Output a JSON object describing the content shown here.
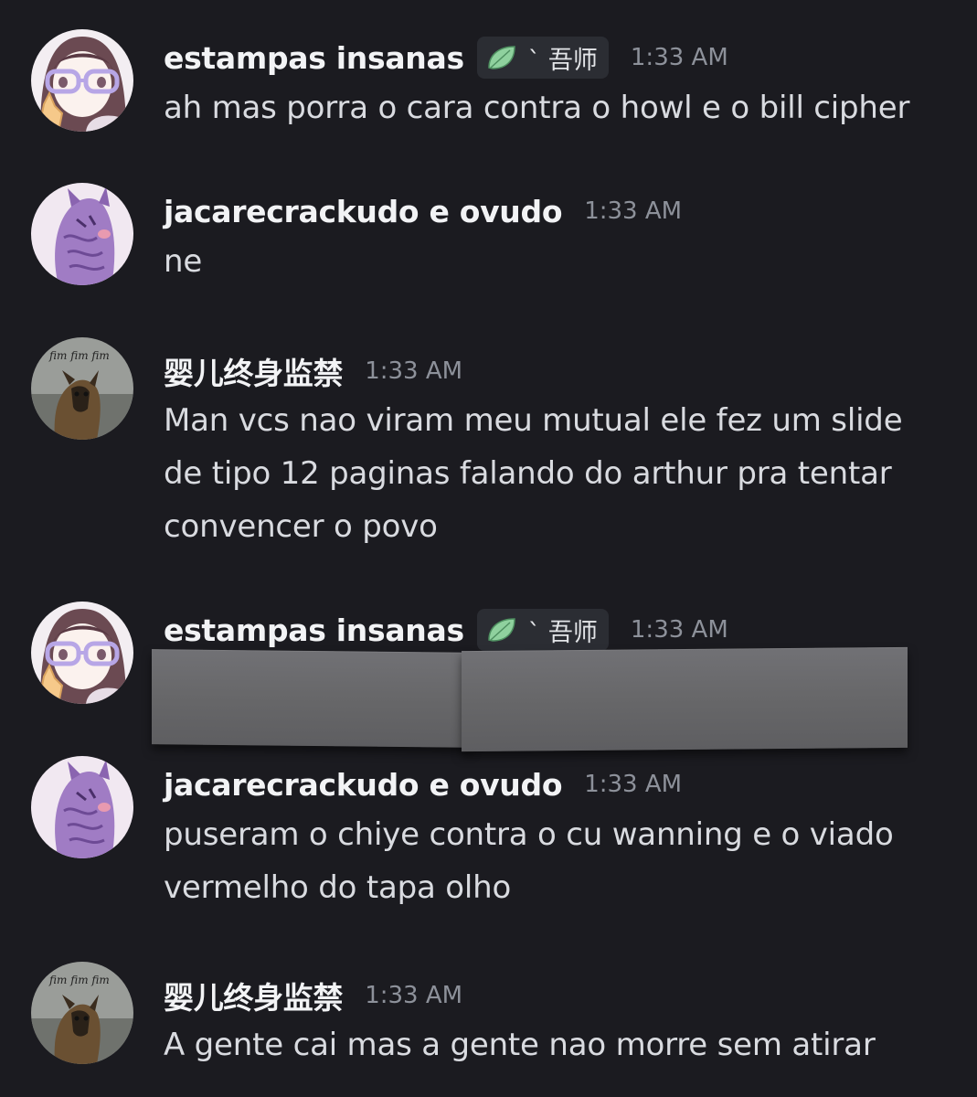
{
  "colors": {
    "background": "#1b1b20",
    "username": "#f2f3f5",
    "timestamp": "#8d919a",
    "message_text": "#d9dbe0",
    "tag_background": "#2b2d33",
    "tag_leaf": "#8fd19e",
    "redaction": "#6a6a6d"
  },
  "messages": [
    {
      "username": "estampas insanas",
      "avatar": "anime-glasses-avatar",
      "tag": {
        "icon": "leaf-icon",
        "text": "` 吾师"
      },
      "time": "1:33 AM",
      "lines": [
        "ah mas porra o cara contra o howl e o bill cipher"
      ]
    },
    {
      "username": "jacarecrackudo e ovudo",
      "avatar": "purple-drawing-avatar",
      "time": "1:33 AM",
      "lines": [
        "ne"
      ]
    },
    {
      "username": "婴儿终身监禁",
      "avatar": "dog-photo-avatar",
      "avatar_caption": "fim fim fim",
      "time": "1:33 AM",
      "lines": [
        "Man vcs nao viram meu mutual ele fez um slide",
        "de tipo 12 paginas falando do arthur pra tentar",
        "convencer o povo"
      ]
    },
    {
      "username": "estampas insanas",
      "avatar": "anime-glasses-avatar",
      "tag": {
        "icon": "leaf-icon",
        "text": "` 吾师"
      },
      "time": "1:33 AM",
      "lines": [],
      "redacted": true
    },
    {
      "username": "jacarecrackudo e ovudo",
      "avatar": "purple-drawing-avatar",
      "time": "1:33 AM",
      "lines": [
        "puseram o chiye contra o cu wanning e o viado",
        "vermelho do tapa olho"
      ]
    },
    {
      "username": "婴儿终身监禁",
      "avatar": "dog-photo-avatar",
      "avatar_caption": "fim fim fim",
      "time": "1:33 AM",
      "lines": [
        "A gente cai mas a gente nao morre sem atirar"
      ]
    }
  ]
}
